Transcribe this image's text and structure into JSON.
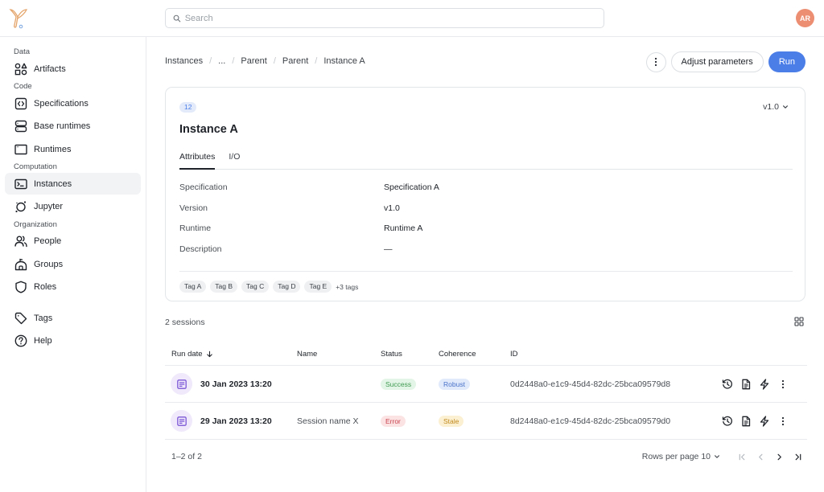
{
  "app": {
    "search_placeholder": "Search",
    "avatar_initials": "AR",
    "colors": {
      "accent": "#4c7ee8",
      "avatar": "#ec8e72",
      "logo": "#e4a56c"
    }
  },
  "sidebar": {
    "sections": [
      {
        "label": "Data",
        "items": [
          {
            "label": "Artifacts",
            "icon": "artifacts-icon"
          }
        ]
      },
      {
        "label": "Code",
        "items": [
          {
            "label": "Specifications",
            "icon": "code-icon"
          },
          {
            "label": "Base runtimes",
            "icon": "server-icon"
          },
          {
            "label": "Runtimes",
            "icon": "window-icon"
          }
        ]
      },
      {
        "label": "Computation",
        "items": [
          {
            "label": "Instances",
            "icon": "terminal-icon",
            "active": true
          },
          {
            "label": "Jupyter",
            "icon": "jupyter-icon"
          }
        ]
      },
      {
        "label": "Organization",
        "items": [
          {
            "label": "People",
            "icon": "people-icon"
          },
          {
            "label": "Groups",
            "icon": "groups-icon"
          },
          {
            "label": "Roles",
            "icon": "shield-icon"
          }
        ]
      }
    ],
    "footer_items": [
      {
        "label": "Tags",
        "icon": "tag-icon"
      },
      {
        "label": "Help",
        "icon": "help-icon"
      }
    ]
  },
  "breadcrumb": [
    "Instances",
    "...",
    "Parent",
    "Parent",
    "Instance A"
  ],
  "toolbar": {
    "adjust_label": "Adjust parameters",
    "run_label": "Run"
  },
  "instance": {
    "id_badge": "12",
    "version_selected": "v1.0",
    "title": "Instance A",
    "tabs": [
      {
        "label": "Attributes",
        "active": true
      },
      {
        "label": "I/O",
        "active": false
      }
    ],
    "attributes": [
      {
        "label": "Specification",
        "value": "Specification A"
      },
      {
        "label": "Version",
        "value": "v1.0"
      },
      {
        "label": "Runtime",
        "value": "Runtime A"
      },
      {
        "label": "Description",
        "value": "—"
      }
    ],
    "tags": [
      "Tag A",
      "Tag B",
      "Tag C",
      "Tag D",
      "Tag E"
    ],
    "tags_more": "+3 tags"
  },
  "sessions": {
    "count_label": "2 sessions",
    "columns": [
      "Run date",
      "Name",
      "Status",
      "Coherence",
      "ID"
    ],
    "rows": [
      {
        "run_date": "30 Jan 2023 13:20",
        "name": "",
        "status": "Success",
        "coherence": "Robust",
        "id": "0d2448a0-e1c9-45d4-82dc-25bca09579d8"
      },
      {
        "run_date": "29 Jan 2023 13:20",
        "name": "Session name X",
        "status": "Error",
        "coherence": "Stale",
        "id": "8d2448a0-e1c9-45d4-82dc-25bca09579d0"
      }
    ],
    "badge_colors": {
      "Success": {
        "bg": "#e3f5e6",
        "fg": "#3f9a52"
      },
      "Error": {
        "bg": "#fbe3e4",
        "fg": "#c9444f"
      },
      "Robust": {
        "bg": "#e1eafb",
        "fg": "#4a72c9"
      },
      "Stale": {
        "bg": "#fcf0d2",
        "fg": "#c08a1e"
      }
    },
    "pagination": {
      "range": "1–2 of 2",
      "rows_per_page_label": "Rows per page",
      "rows_per_page": "10"
    }
  }
}
